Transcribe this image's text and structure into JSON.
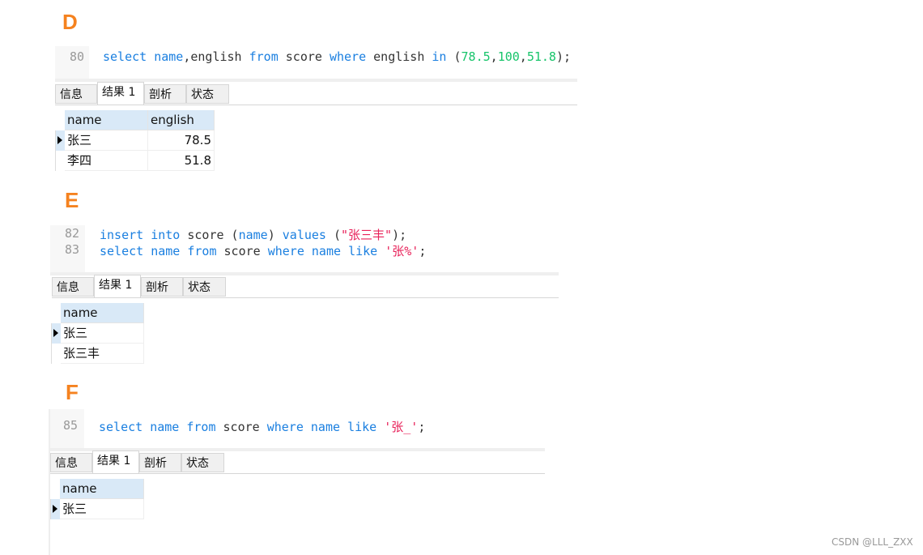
{
  "colors": {
    "label": "#f5821f",
    "keyword": "#1a7fe0",
    "number": "#17c46a",
    "string": "#e8225a",
    "text": "#333333"
  },
  "tabs": [
    "信息",
    "结果 1",
    "剖析",
    "状态"
  ],
  "active_tab": 1,
  "panels": [
    {
      "label": "D",
      "lines": [
        {
          "num": "80",
          "tokens": [
            {
              "t": "select ",
              "c": "keyword"
            },
            {
              "t": "name",
              "c": "keyword"
            },
            {
              "t": ",english ",
              "c": "text"
            },
            {
              "t": "from ",
              "c": "keyword"
            },
            {
              "t": "score ",
              "c": "text"
            },
            {
              "t": "where ",
              "c": "keyword"
            },
            {
              "t": "english ",
              "c": "text"
            },
            {
              "t": "in ",
              "c": "keyword"
            },
            {
              "t": "(",
              "c": "text"
            },
            {
              "t": "78.5",
              "c": "number"
            },
            {
              "t": ",",
              "c": "text"
            },
            {
              "t": "100",
              "c": "number"
            },
            {
              "t": ",",
              "c": "text"
            },
            {
              "t": "51.8",
              "c": "number"
            },
            {
              "t": ");",
              "c": "text"
            }
          ]
        }
      ],
      "columns": [
        "name",
        "english"
      ],
      "rows": [
        [
          "张三",
          "78.5"
        ],
        [
          "李四",
          "51.8"
        ]
      ]
    },
    {
      "label": "E",
      "lines": [
        {
          "num": "82",
          "tokens": [
            {
              "t": "insert ",
              "c": "keyword"
            },
            {
              "t": "into ",
              "c": "keyword"
            },
            {
              "t": "score (",
              "c": "text"
            },
            {
              "t": "name",
              "c": "keyword"
            },
            {
              "t": ") ",
              "c": "text"
            },
            {
              "t": "values ",
              "c": "keyword"
            },
            {
              "t": "(",
              "c": "text"
            },
            {
              "t": "\"张三丰\"",
              "c": "string"
            },
            {
              "t": ");",
              "c": "text"
            }
          ]
        },
        {
          "num": "83",
          "tokens": [
            {
              "t": "select ",
              "c": "keyword"
            },
            {
              "t": "name ",
              "c": "keyword"
            },
            {
              "t": "from ",
              "c": "keyword"
            },
            {
              "t": "score ",
              "c": "text"
            },
            {
              "t": "where ",
              "c": "keyword"
            },
            {
              "t": "name ",
              "c": "keyword"
            },
            {
              "t": "like ",
              "c": "keyword"
            },
            {
              "t": "'张%'",
              "c": "string"
            },
            {
              "t": ";",
              "c": "text"
            }
          ]
        }
      ],
      "columns": [
        "name"
      ],
      "rows": [
        [
          "张三"
        ],
        [
          "张三丰"
        ]
      ]
    },
    {
      "label": "F",
      "lines": [
        {
          "num": "85",
          "tokens": [
            {
              "t": "select ",
              "c": "keyword"
            },
            {
              "t": "name ",
              "c": "keyword"
            },
            {
              "t": "from ",
              "c": "keyword"
            },
            {
              "t": "score ",
              "c": "text"
            },
            {
              "t": "where ",
              "c": "keyword"
            },
            {
              "t": "name ",
              "c": "keyword"
            },
            {
              "t": "like ",
              "c": "keyword"
            },
            {
              "t": "'张_'",
              "c": "string"
            },
            {
              "t": ";",
              "c": "text"
            }
          ]
        }
      ],
      "columns": [
        "name"
      ],
      "rows": [
        [
          "张三"
        ]
      ]
    }
  ],
  "watermark": "CSDN @LLL_ZXX"
}
